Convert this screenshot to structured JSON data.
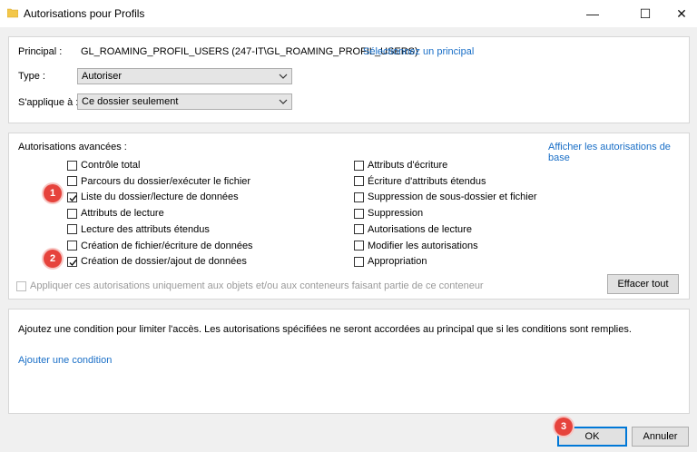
{
  "window": {
    "title": "Autorisations pour Profils",
    "controls": {
      "minimize": "—",
      "maximize": "☐",
      "close": "✕"
    }
  },
  "principal": {
    "label": "Principal :",
    "value": "GL_ROAMING_PROFIL_USERS (247-IT\\GL_ROAMING_PROFIL_USERS)",
    "select_link": "Sélectionnez un principal"
  },
  "type": {
    "label": "Type :",
    "value": "Autoriser"
  },
  "applies_to": {
    "label": "S'applique à :",
    "value": "Ce dossier seulement"
  },
  "advanced": {
    "label": "Autorisations avancées :",
    "show_basic_link": "Afficher les autorisations de base",
    "left": [
      {
        "label": "Contrôle total",
        "checked": false
      },
      {
        "label": "Parcours du dossier/exécuter le fichier",
        "checked": false
      },
      {
        "label": "Liste du dossier/lecture de données",
        "checked": true
      },
      {
        "label": "Attributs de lecture",
        "checked": false
      },
      {
        "label": "Lecture des attributs étendus",
        "checked": false
      },
      {
        "label": "Création de fichier/écriture de données",
        "checked": false
      },
      {
        "label": "Création de dossier/ajout de données",
        "checked": true
      }
    ],
    "right": [
      {
        "label": "Attributs d'écriture",
        "checked": false
      },
      {
        "label": "Écriture d'attributs étendus",
        "checked": false
      },
      {
        "label": "Suppression de sous-dossier et fichier",
        "checked": false
      },
      {
        "label": "Suppression",
        "checked": false
      },
      {
        "label": "Autorisations de lecture",
        "checked": false
      },
      {
        "label": "Modifier les autorisations",
        "checked": false
      },
      {
        "label": "Appropriation",
        "checked": false
      }
    ],
    "apply_inherit": {
      "label": "Appliquer ces autorisations uniquement aux objets et/ou aux conteneurs faisant partie de ce conteneur",
      "checked": false
    },
    "clear_all": "Effacer tout"
  },
  "condition": {
    "text": "Ajoutez une condition pour limiter l'accès. Les autorisations spécifiées ne seront accordées au principal que si les conditions sont remplies.",
    "add_link": "Ajouter une condition"
  },
  "footer": {
    "ok": "OK",
    "cancel": "Annuler"
  },
  "annotations": [
    "1",
    "2",
    "3"
  ],
  "colors": {
    "link": "#1a6fc7",
    "badge": "#e6433c",
    "ok_border": "#0078d7"
  }
}
